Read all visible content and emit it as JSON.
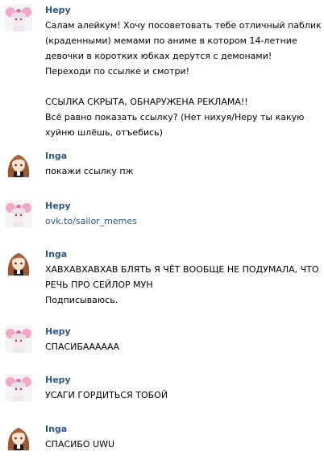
{
  "colors": {
    "name": "#2a5885",
    "link": "#2a5885",
    "text": "#000000",
    "background": "#ffffff"
  },
  "messages": [
    {
      "author": "Нерy",
      "avatar_icon": "pink-bow-anime-avatar",
      "lines": [
        "Салам алейкум! Хочу посоветовать тебе отличный паблик с",
        "(краденными) мемами по аниме в котором 14-летние",
        "девочки в коротких юбках дерутся с демонами!",
        "Переходи по ссылке и смотри!",
        "",
        "ССЫЛКА СКРЫТА, ОБНАРУЖЕНА РЕКЛАМА!!",
        "Всё равно показать ссылку? (Нет нихуя/Нерy ты какую",
        "хуйню шлёшь, отъебись)"
      ]
    },
    {
      "author": "Inga",
      "avatar_icon": "brown-hair-anime-avatar",
      "lines": [
        "покажи ссылку пж"
      ]
    },
    {
      "author": "Нерy",
      "avatar_icon": "pink-bow-anime-avatar",
      "link": "ovk.to/sailor_memes"
    },
    {
      "author": "Inga",
      "avatar_icon": "brown-hair-anime-avatar",
      "lines": [
        "ХАВХАВХАВХАВ БЛЯТЬ Я ЧЁТ ВООБЩЕ НЕ ПОДУМАЛА, ЧТО",
        "РЕЧЬ ПРО СЕЙЛОР МУН",
        "Подписываюсь."
      ]
    },
    {
      "author": "Нерy",
      "avatar_icon": "pink-bow-anime-avatar",
      "lines": [
        "СПАСИБАААААА"
      ]
    },
    {
      "author": "Нерy",
      "avatar_icon": "pink-bow-anime-avatar",
      "lines": [
        "УСАГИ ГОРДИТЬСЯ ТОБОЙ"
      ]
    },
    {
      "author": "Inga",
      "avatar_icon": "brown-hair-anime-avatar",
      "lines": [
        "СПАСИБО UWU"
      ]
    }
  ]
}
